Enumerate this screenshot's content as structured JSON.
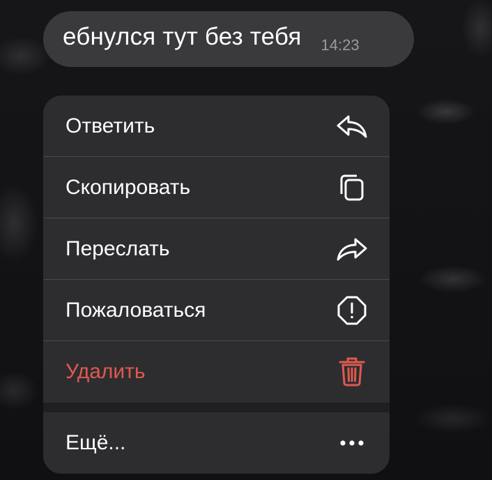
{
  "message": {
    "text": "ебнулся тут без тебя",
    "time": "14:23"
  },
  "menu": {
    "items": [
      {
        "label": "Ответить",
        "icon": "reply-icon"
      },
      {
        "label": "Скопировать",
        "icon": "copy-icon"
      },
      {
        "label": "Переслать",
        "icon": "forward-icon"
      },
      {
        "label": "Пожаловаться",
        "icon": "report-icon"
      },
      {
        "label": "Удалить",
        "icon": "trash-icon",
        "color": "#e0594e"
      }
    ],
    "more": {
      "label": "Ещё...",
      "icon": "more-icon"
    }
  },
  "colors": {
    "bubble": "#3a3a3d",
    "menu_bg": "#2d2d30",
    "danger": "#e0594e"
  }
}
